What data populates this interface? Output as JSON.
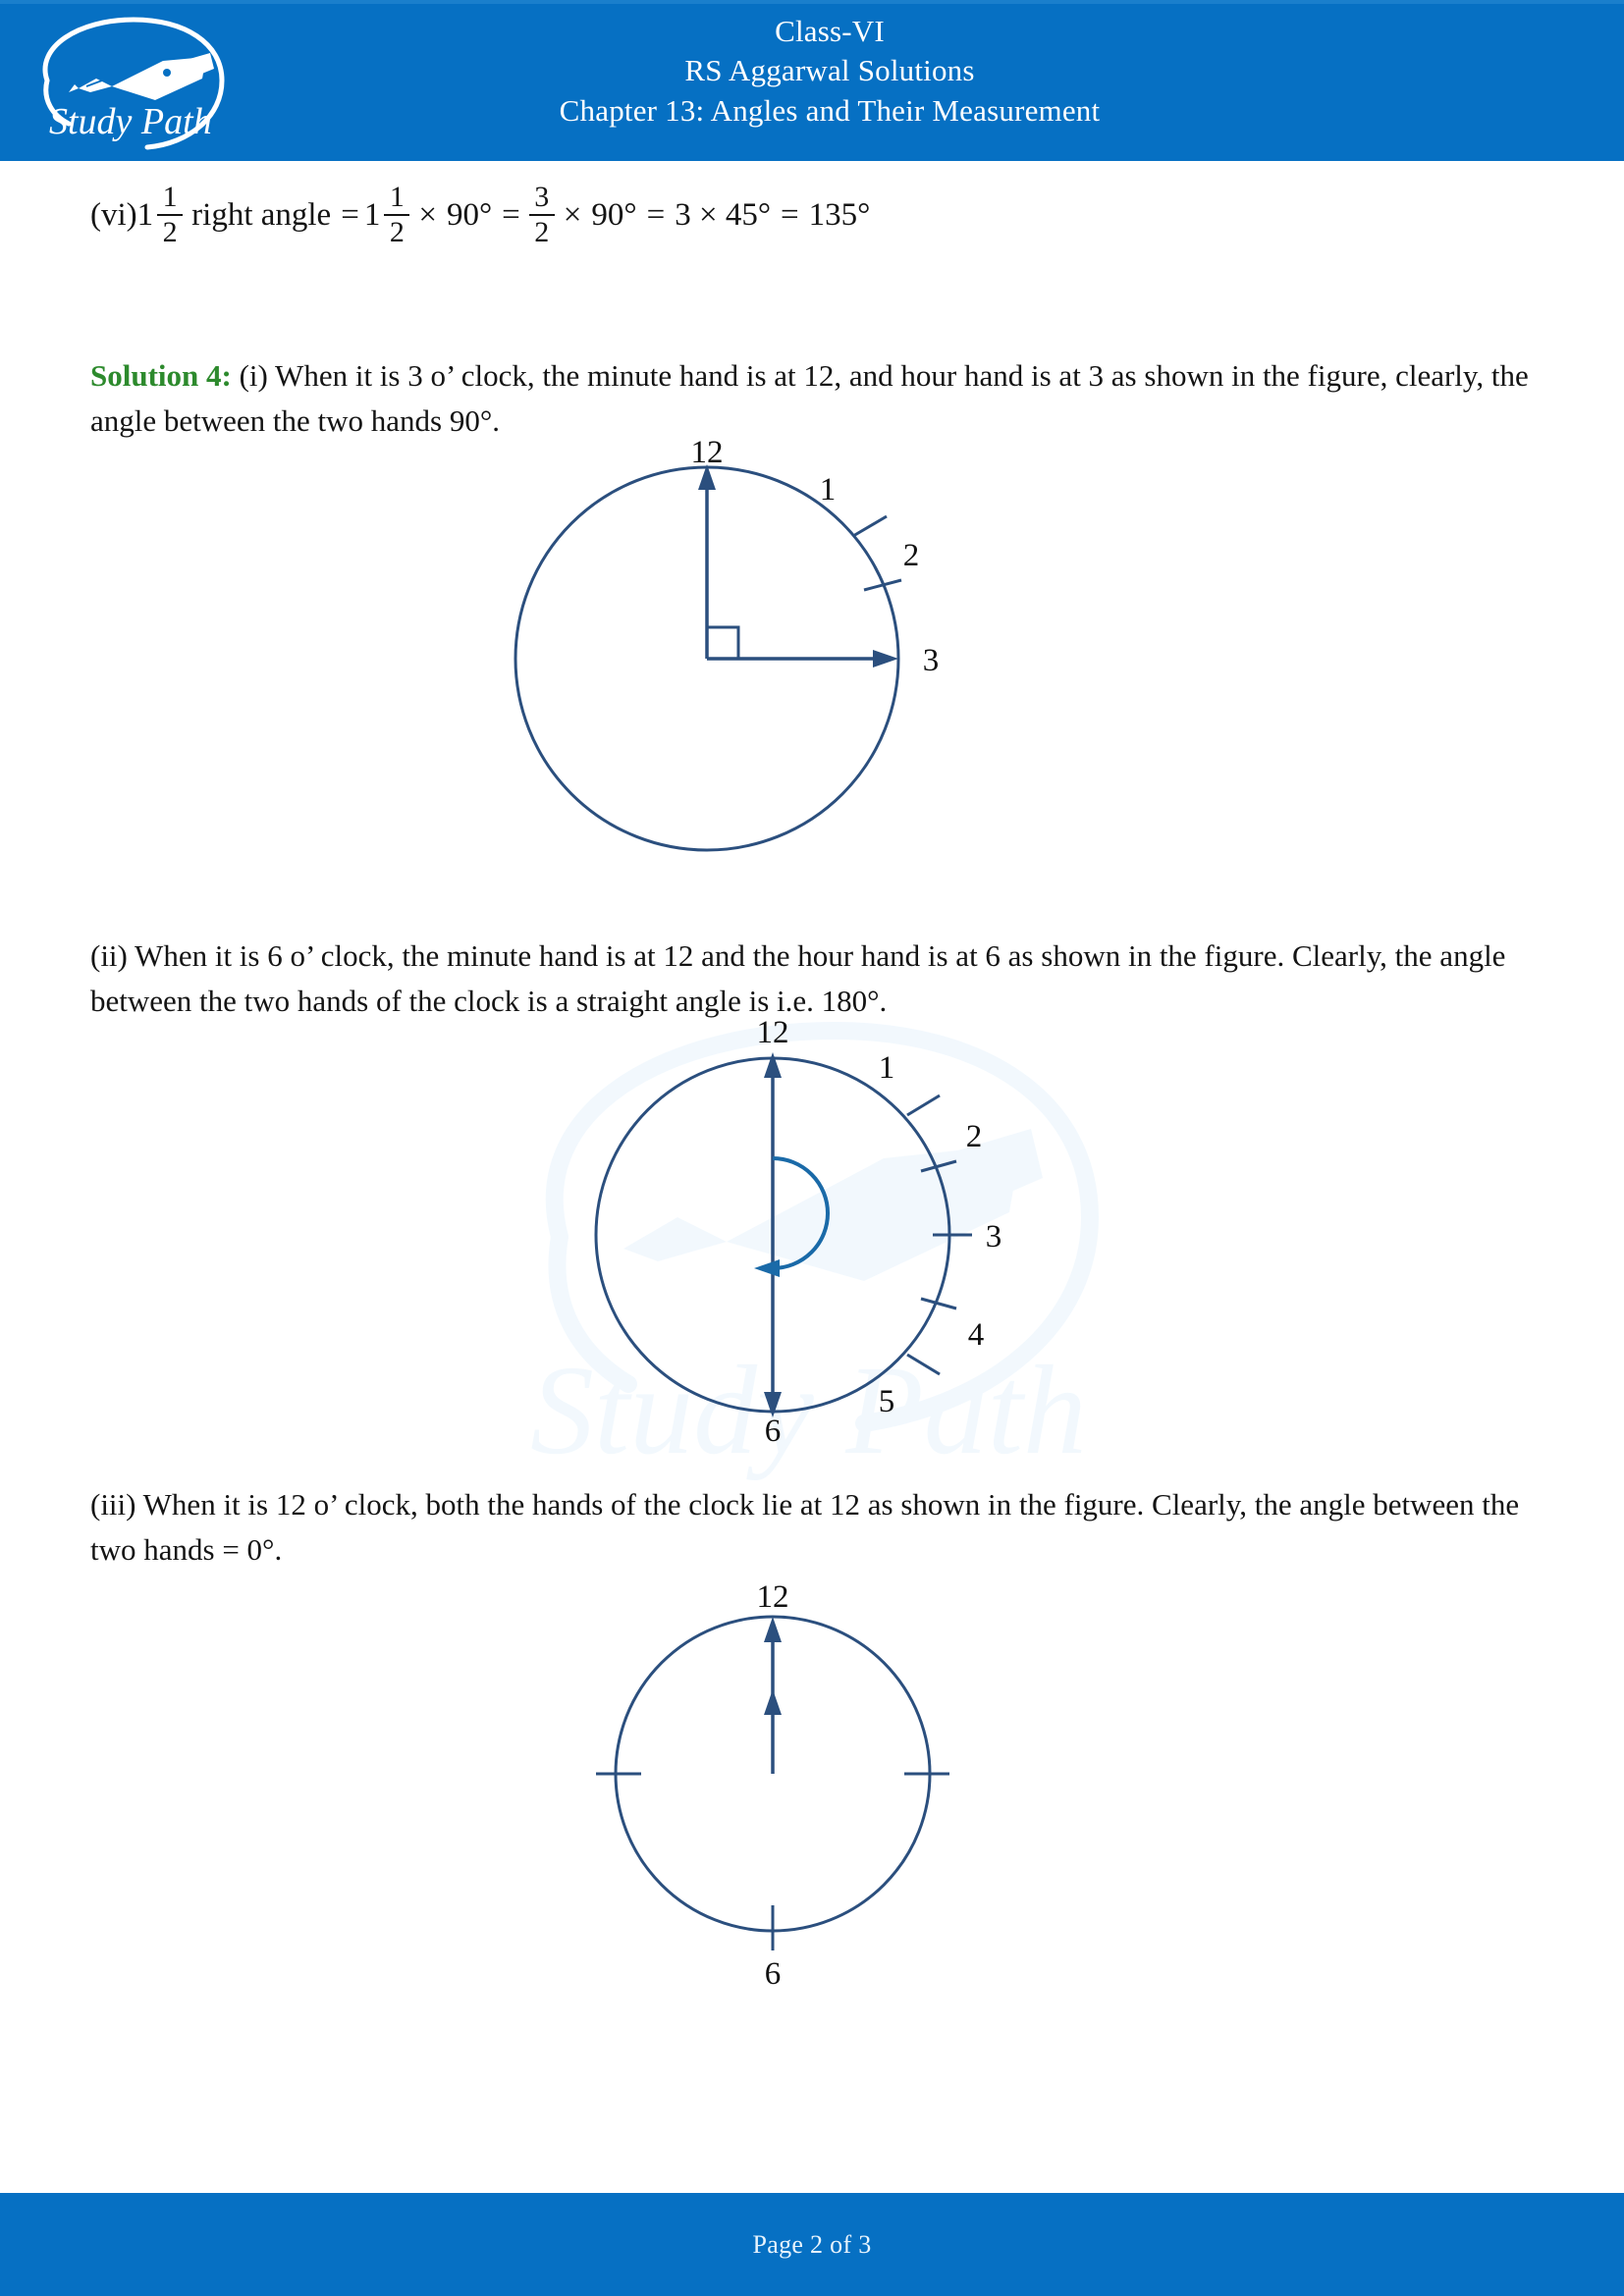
{
  "header": {
    "logo_name": "Study Path",
    "line1": "Class-VI",
    "line2": "RS Aggarwal Solutions",
    "line3": "Chapter 13: Angles and Their Measurement",
    "brand_color": "#0670c3",
    "text_color": "#ffffff"
  },
  "footer": {
    "page_text": "Page 2 of 3"
  },
  "watermark": {
    "text": "Study Path",
    "color": "#dff0fb"
  },
  "equation": {
    "label": "(vi)",
    "whole1": "1",
    "frac1": {
      "num": "1",
      "den": "2"
    },
    "term1": "right angle",
    "eq1": "=",
    "whole2": "1",
    "frac2": {
      "num": "1",
      "den": "2"
    },
    "mul1": "×",
    "val1": "90°",
    "eq2": "=",
    "frac3": {
      "num": "3",
      "den": "2"
    },
    "mul2": "×",
    "val2": "90°",
    "eq3": "=",
    "val3": "3 × 45°",
    "eq4": "=",
    "result": "135°"
  },
  "solution": {
    "label": "Solution 4:",
    "part_i": " (i) When it is 3 o’ clock, the minute hand is at 12, and hour hand is at 3 as shown in the figure, clearly, the angle between the two hands 90°.",
    "part_ii": "(ii) When it is 6 o’ clock, the minute hand is at 12 and the hour hand is at 6 as shown in the figure. Clearly, the angle between the two hands of the clock is a straight angle is i.e. 180°.",
    "part_iii": "(iii) When it is 12 o’ clock, both the hands of the clock lie at 12 as shown in the figure. Clearly, the angle between the two hands = 0°."
  },
  "figures": {
    "line_color": "#2b4f7e",
    "clock1": {
      "caption": "3 o' clock, 90 degrees",
      "labels": {
        "l12": "12",
        "l1": "1",
        "l2": "2",
        "l3": "3"
      },
      "hands": [
        "minute-hand-at-12",
        "hour-hand-at-3"
      ],
      "marker": "right-angle-square"
    },
    "clock2": {
      "caption": "6 o' clock, 180 degrees",
      "labels": {
        "l12": "12",
        "l1": "1",
        "l2": "2",
        "l3": "3",
        "l4": "4",
        "l5": "5",
        "l6": "6"
      },
      "hands": [
        "minute-hand-at-12",
        "hour-hand-at-6"
      ],
      "marker": "semicircular-arc-arrow"
    },
    "clock3": {
      "caption": "12 o' clock, 0 degrees",
      "labels": {
        "l12": "12",
        "l6": "6"
      },
      "hands": [
        "minute-hand-at-12",
        "hour-hand-at-12"
      ],
      "marker": "none"
    }
  }
}
